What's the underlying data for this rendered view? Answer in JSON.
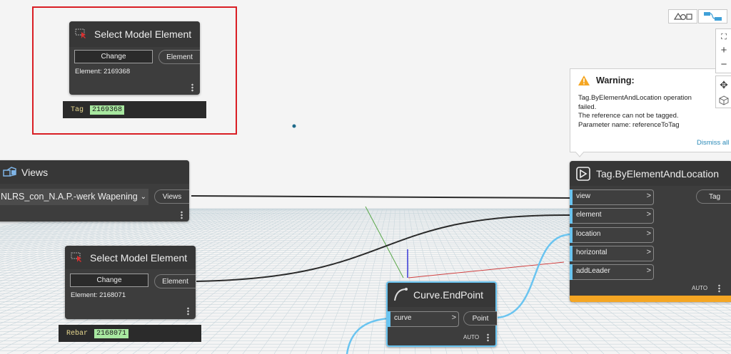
{
  "workspace": {
    "background": "#f4f4f4",
    "grid_color": "#c9d6dc",
    "accent_blue": "#6ac4f0",
    "warning_orange": "#f5a623",
    "highlight_red": "#d91e24"
  },
  "nodes": {
    "select_top": {
      "title": "Select Model Element",
      "change_label": "Change",
      "output_port": "Element",
      "element_text": "Element: 2169368",
      "preview_label": "Tag",
      "preview_value": "2169368"
    },
    "views": {
      "title": "Views",
      "dropdown_value": "NLRS_con_N.A.P.-werk Wapening",
      "output_port": "Views"
    },
    "select_bottom": {
      "title": "Select Model Element",
      "change_label": "Change",
      "output_port": "Element",
      "element_text": "Element: 2168071",
      "preview_label": "Rebar",
      "preview_value": "2168071"
    },
    "curve_endpoint": {
      "title": "Curve.EndPoint",
      "input": "curve",
      "input_arrow": ">",
      "output_port": "Point",
      "lacing": "AUTO"
    },
    "tag": {
      "title": "Tag.ByElementAndLocation",
      "inputs": [
        "view",
        "element",
        "location",
        "horizontal",
        "addLeader"
      ],
      "input_arrow": ">",
      "output_port": "Tag",
      "lacing": "AUTO"
    }
  },
  "warning": {
    "title": "Warning:",
    "message_lines": [
      "Tag.ByElementAndLocation operation",
      "failed.",
      "The reference can not be tagged.",
      "Parameter name: referenceToTag"
    ],
    "dismiss_label": "Dismiss all"
  },
  "toolbar": {
    "view_toggle": [
      "geometry-view-icon",
      "graph-view-icon"
    ],
    "zoom": [
      "fit-view-icon",
      "zoom-in-icon",
      "zoom-out-icon",
      "pan-icon",
      "orbit-icon"
    ]
  }
}
